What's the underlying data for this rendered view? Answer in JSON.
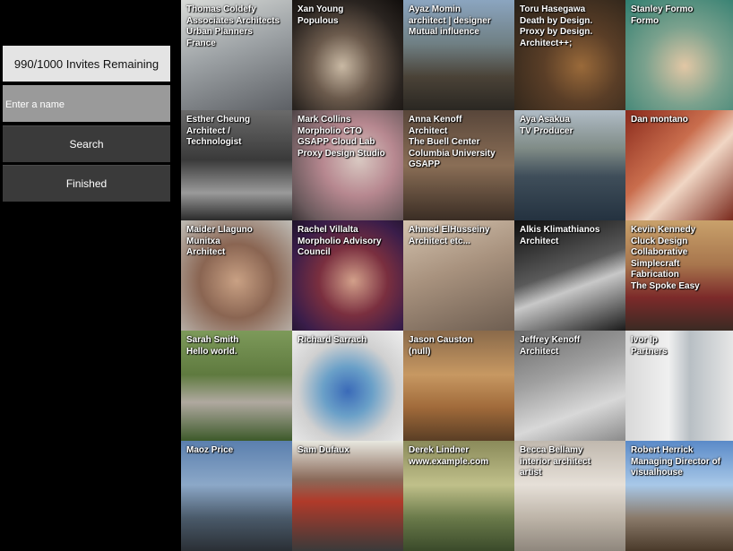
{
  "sidebar": {
    "invites_label": "990/1000 Invites Remaining",
    "name_placeholder": "Enter a name",
    "search_label": "Search",
    "finished_label": "Finished"
  },
  "tiles": [
    {
      "lines": [
        "Thomas Coldefy",
        "Associates Architects",
        "Urban Planners",
        "France"
      ],
      "bg": "linear-gradient(160deg,#d9dbd8 0%,#9ea3a6 45%,#5d6065 100%)"
    },
    {
      "lines": [
        "Xan Young",
        "Populous"
      ],
      "bg": "radial-gradient(ellipse at 45% 60%,#c9b9a4 0%,#6b5a4c 35%,#2a2420 70%,#100d0b 100%)"
    },
    {
      "lines": [
        "Ayaz Momin",
        "architect | designer",
        "Mutual influence"
      ],
      "bg": "linear-gradient(180deg,#8ba5c0 0%,#6f7f83 40%,#4a4237 70%,#2a2722 100%)"
    },
    {
      "lines": [
        "Toru Hasegawa",
        "Death by Design.",
        "Proxy by Design.",
        "Architect++;"
      ],
      "bg": "radial-gradient(circle at 60% 60%,#9a6a3a 0%,#5a3e27 40%,#262018 100%)"
    },
    {
      "lines": [
        "Stanley Formo",
        "Formo"
      ],
      "bg": "radial-gradient(circle at 55% 60%,#e2c7a5 0%,#7aa18d 45%,#2f7e70 100%)"
    },
    {
      "lines": [
        "Esther Cheung",
        "Architect /",
        "Technologist"
      ],
      "bg": "linear-gradient(180deg,#6a6a6a 0%,#3a3a3a 45%,#9a9a9a 75%,#2a2a2a 100%)"
    },
    {
      "lines": [
        "Mark Collins",
        "Morpholio CTO",
        "GSAPP Cloud Lab",
        "Proxy Design Studio"
      ],
      "bg": "radial-gradient(circle at 60% 45%,#d9c9c2 0%,#b78890 40%,#6b5a5d 80%,#3a3335 100%)"
    },
    {
      "lines": [
        "Anna Kenoff",
        "Architect",
        "The Buell Center",
        "Columbia University",
        "GSAPP"
      ],
      "bg": "linear-gradient(180deg,#58463a 0%,#8a6e56 50%,#3a2d24 100%)"
    },
    {
      "lines": [
        "Aya Asakua",
        "TV Producer"
      ],
      "bg": "linear-gradient(180deg,#b0bcc6 0%,#7f8b86 35%,#3f4e5a 60%,#243240 100%)"
    },
    {
      "lines": [
        "Dan montano"
      ],
      "bg": "linear-gradient(135deg,#8a2a1c 0%,#c96d4d 40%,#f0d6c4 60%,#7a2a1d 100%)"
    },
    {
      "lines": [
        "Maider Llaguno",
        "Munitxa",
        "Architect"
      ],
      "bg": "radial-gradient(circle at 50% 55%,#c9a184 0%,#8a6552 45%,#bfbdb7 100%)"
    },
    {
      "lines": [
        "Rachel Villalta",
        "Morpholio Advisory",
        "Council"
      ],
      "bg": "radial-gradient(circle at 55% 55%,#d2a08a 0%,#7a2f3f 40%,#3a1d4a 75%,#1d1228 100%)"
    },
    {
      "lines": [
        "Ahmed ElHusseiny",
        "Architect etc..."
      ],
      "bg": "linear-gradient(160deg,#d3c2ae 0%,#a8927e 45%,#6e5e51 100%)"
    },
    {
      "lines": [
        "Alkis Klimathianos",
        "Architect"
      ],
      "bg": "linear-gradient(160deg,#0d0d0d 0%,#5a5a5a 45%,#c8c8c8 60%,#1a1a1a 100%)"
    },
    {
      "lines": [
        "Kevin Kennedy",
        "Cluck Design",
        "Collaborative",
        "Simplecraft Fabrication",
        "The Spoke Easy"
      ],
      "bg": "linear-gradient(180deg,#c9a16b 0%,#a8764d 40%,#7c2a2a 70%,#3a2a23 100%)"
    },
    {
      "lines": [
        "Sarah Smith",
        "Hello world."
      ],
      "bg": "linear-gradient(180deg,#7d9a5a 0%,#5f7a3f 40%,#b0a9a0 65%,#3d5a2a 100%)"
    },
    {
      "lines": [
        "Richard Sarrach"
      ],
      "bg": "radial-gradient(circle at 50% 55%,#3a6ab8 0%,#6aa0c8 30%,#d0d0d0 60%,#efefef 100%)"
    },
    {
      "lines": [
        "Jason Causton",
        "(null)"
      ],
      "bg": "linear-gradient(180deg,#8a6a4a 0%,#c79862 40%,#a06a3a 70%,#5a3e25 100%)"
    },
    {
      "lines": [
        "Jeffrey Kenoff",
        "Architect"
      ],
      "bg": "linear-gradient(160deg,#6a6a6a 0%,#a0a0a0 40%,#d8d8d8 70%,#8a8a8a 100%)"
    },
    {
      "lines": [
        "Ivor Ip",
        "Partners"
      ],
      "bg": "linear-gradient(90deg,#d8d8d8 0%,#f0f0f0 40%,#b8bfc4 60%,#e6e6e6 100%)"
    },
    {
      "lines": [
        "Maoz Price"
      ],
      "bg": "linear-gradient(180deg,#5a7fae 0%,#8ca8c8 40%,#4a5a6a 70%,#2a2f35 100%)"
    },
    {
      "lines": [
        "Sam Dufaux"
      ],
      "bg": "linear-gradient(180deg,#e8e8e0 0%,#8a6a5a 35%,#b03a2a 55%,#3a3a3a 100%)"
    },
    {
      "lines": [
        "Derek Lindner",
        "www.example.com"
      ],
      "bg": "linear-gradient(180deg,#8a8a5a 0%,#c0c08a 40%,#6a7a4a 70%,#3a4a2a 100%)"
    },
    {
      "lines": [
        "Becca Bellamy",
        "interior architect",
        "artist"
      ],
      "bg": "linear-gradient(180deg,#c0b8ae 0%,#e6e0d8 40%,#bdb4a8 70%,#8f877d 100%)"
    },
    {
      "lines": [
        "Robert Herrick",
        "Managing Director of",
        "visualhouse"
      ],
      "bg": "linear-gradient(180deg,#5a8ac8 0%,#a8c8e8 40%,#8a7a6a 70%,#4a3a2a 100%)"
    }
  ]
}
